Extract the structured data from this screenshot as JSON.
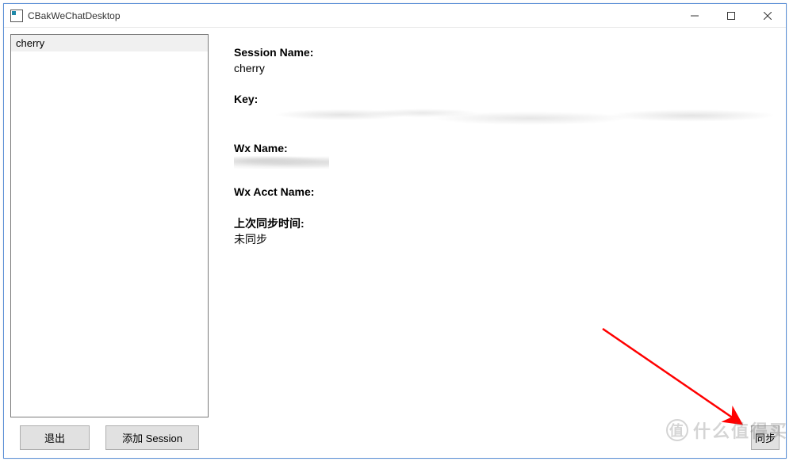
{
  "titlebar": {
    "title": "CBakWeChatDesktop"
  },
  "sidebar": {
    "items": [
      {
        "label": "cherry"
      }
    ]
  },
  "details": {
    "session_name_label": "Session Name:",
    "session_name_value": "cherry",
    "key_label": "Key:",
    "key_value": "",
    "wx_name_label": "Wx Name:",
    "wx_name_value": "",
    "wx_acct_label": "Wx Acct Name:",
    "wx_acct_value": "",
    "last_sync_label": "上次同步时间:",
    "last_sync_value": "未同步"
  },
  "buttons": {
    "exit": "退出",
    "add_session": "添加 Session",
    "sync": "同步"
  },
  "watermark": {
    "icon": "值",
    "text": "什么值得买"
  }
}
